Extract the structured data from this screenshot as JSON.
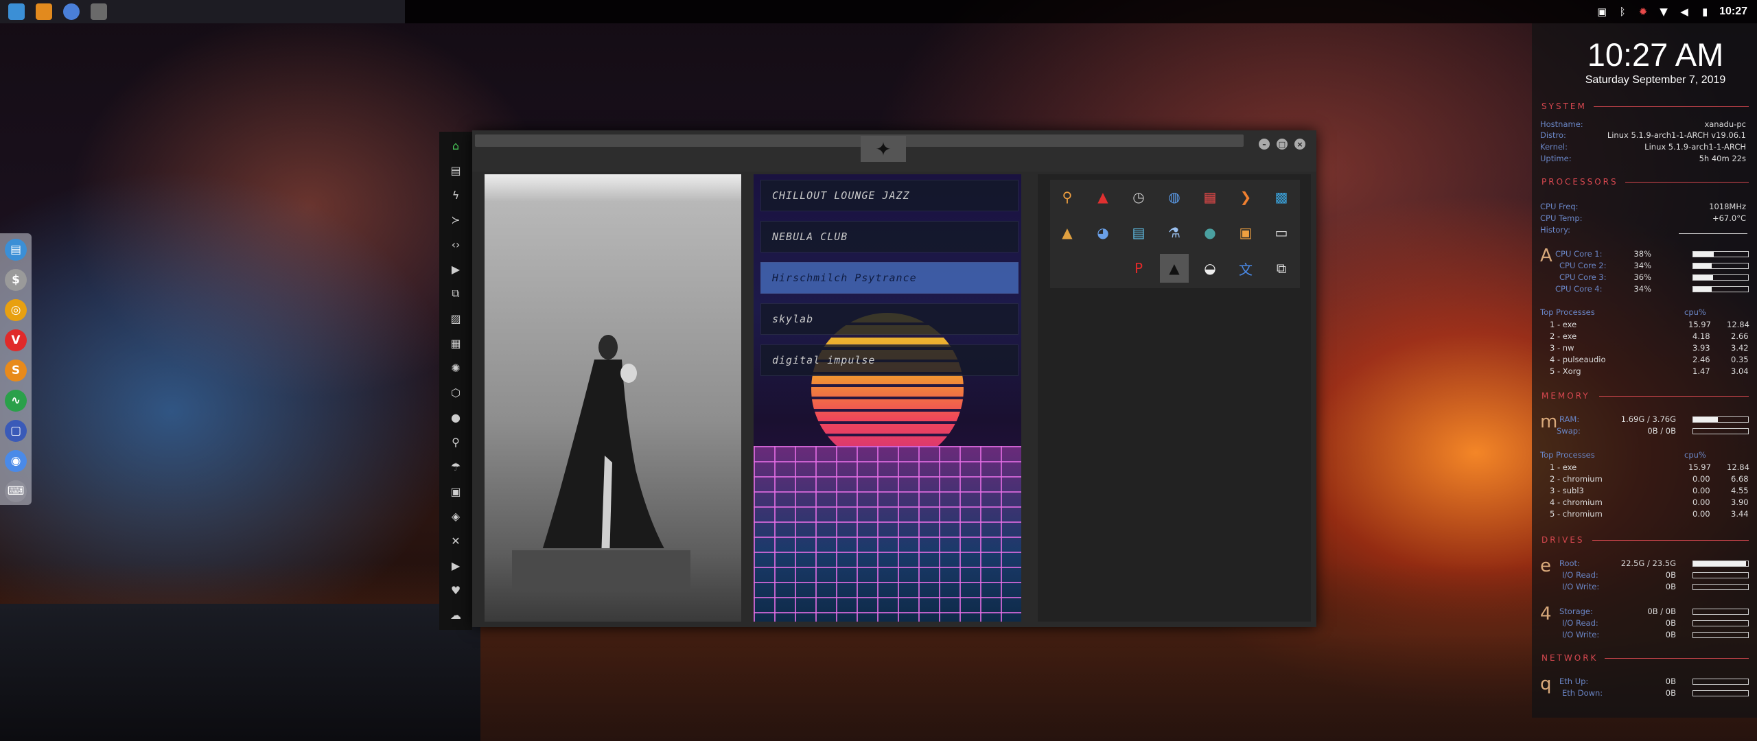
{
  "topbar": {
    "launchers": [
      "file-manager-icon",
      "sublime-icon",
      "chromium-icon",
      "terminal-icon"
    ],
    "tray_icons": [
      "image-icon",
      "bluetooth-icon",
      "settings-icon",
      "wifi-icon",
      "volume-icon",
      "battery-icon"
    ],
    "clock": "10:27"
  },
  "dock": {
    "items": [
      "file-manager",
      "system",
      "ubuntu",
      "vivaldi",
      "sublime",
      "monitor",
      "display",
      "chromium",
      "keyboard"
    ]
  },
  "window": {
    "playlist": [
      "CHILLOUT LOUNGE JAZZ",
      "NEBULA CLUB",
      "Hirschmilch Psytrance",
      "skylab",
      "digital impulse"
    ],
    "active_playlist_index": 2
  },
  "conky": {
    "time": "10:27 AM",
    "date": "Saturday September  7, 2019",
    "system": {
      "header": "SYSTEM",
      "rows": [
        {
          "k": "Hostname:",
          "v": "xanadu-pc"
        },
        {
          "k": "Distro:",
          "v": "Linux 5.1.9-arch1-1-ARCH v19.06.1"
        },
        {
          "k": "Kernel:",
          "v": "Linux 5.1.9-arch1-1-ARCH"
        },
        {
          "k": "Uptime:",
          "v": "5h 40m 22s"
        }
      ]
    },
    "processors": {
      "header": "PROCESSORS",
      "freq_k": "CPU Freq:",
      "freq_v": "1018MHz",
      "temp_k": "CPU Temp:",
      "temp_v": "+67.0°C",
      "hist_k": "History:",
      "big": "A",
      "cores": [
        {
          "k": "CPU Core 1:",
          "v": "38%",
          "pct": 38
        },
        {
          "k": "CPU Core 2:",
          "v": "34%",
          "pct": 34
        },
        {
          "k": "CPU Core 3:",
          "v": "36%",
          "pct": 36
        },
        {
          "k": "CPU Core 4:",
          "v": "34%",
          "pct": 34
        }
      ],
      "top_label": "Top Processes",
      "top_col": "cpu%",
      "top": [
        {
          "n": "1 - exe",
          "a": "15.97",
          "b": "12.84"
        },
        {
          "n": "2 - exe",
          "a": "4.18",
          "b": "2.66"
        },
        {
          "n": "3 - nw",
          "a": "3.93",
          "b": "3.42"
        },
        {
          "n": "4 - pulseaudio",
          "a": "2.46",
          "b": "0.35"
        },
        {
          "n": "5 - Xorg",
          "a": "1.47",
          "b": "3.04"
        }
      ]
    },
    "memory": {
      "header": "MEMORY",
      "big": "m",
      "ram_k": "RAM:",
      "ram_v": "1.69G / 3.76G",
      "ram_pct": 45,
      "swap_k": "Swap:",
      "swap_v": "0B / 0B",
      "top_label": "Top Processes",
      "top_col": "cpu%",
      "top": [
        {
          "n": "1 - exe",
          "a": "15.97",
          "b": "12.84"
        },
        {
          "n": "2 - chromium",
          "a": "0.00",
          "b": "6.68"
        },
        {
          "n": "3 - subl3",
          "a": "0.00",
          "b": "4.55"
        },
        {
          "n": "4 - chromium",
          "a": "0.00",
          "b": "3.90"
        },
        {
          "n": "5 - chromium",
          "a": "0.00",
          "b": "3.44"
        }
      ]
    },
    "drives": {
      "header": "DRIVES",
      "big1": "e",
      "root_k": "Root:",
      "root_v": "22.5G / 23.5G",
      "root_pct": 96,
      "io_read_k": "I/O Read:",
      "io_read_v": "0B",
      "io_write_k": "I/O Write:",
      "io_write_v": "0B",
      "big2": "4",
      "storage_k": "Storage:",
      "storage_v": "0B / 0B",
      "io2_read_k": "I/O Read:",
      "io2_read_v": "0B",
      "io2_write_k": "I/O Write:",
      "io2_write_v": "0B"
    },
    "network": {
      "header": "NETWORK",
      "big": "q",
      "up_k": "Eth Up:",
      "up_v": "0B",
      "down_k": "Eth Down:",
      "down_v": "0B"
    }
  }
}
